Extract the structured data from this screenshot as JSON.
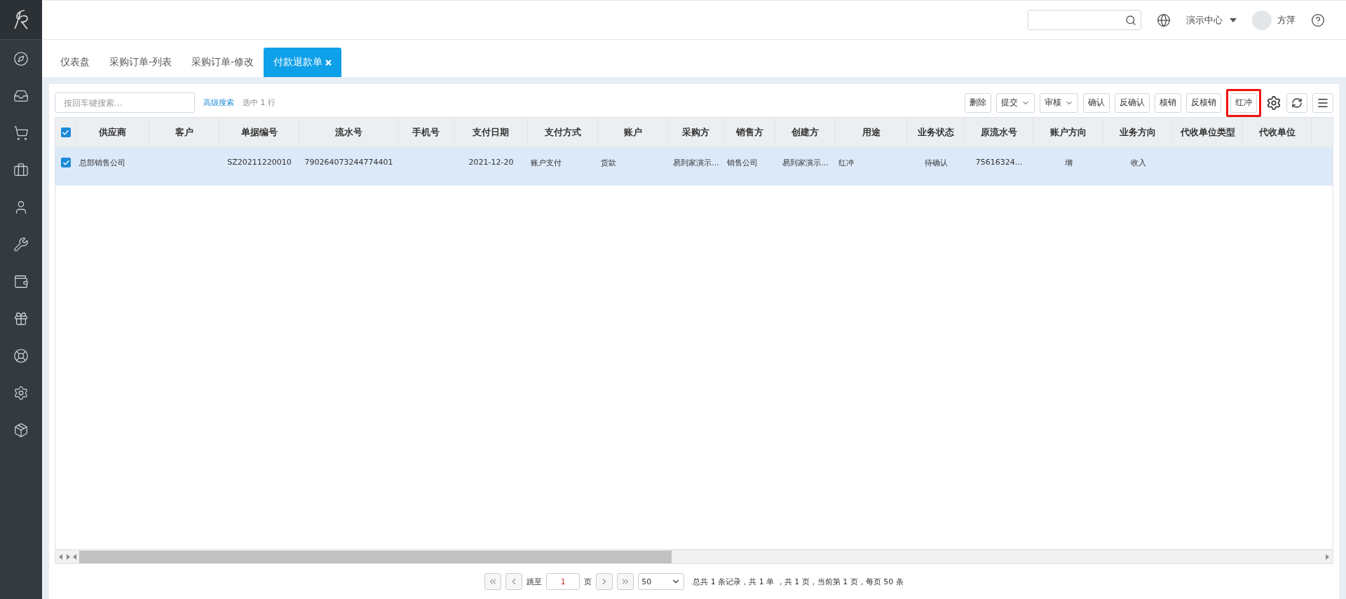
{
  "topbar": {
    "org_menu": "演示中心",
    "user": "方萍"
  },
  "tabs": [
    {
      "label": "仪表盘",
      "selected": false,
      "closable": false
    },
    {
      "label": "采购订单-列表",
      "selected": false,
      "closable": false
    },
    {
      "label": "采购订单-修改",
      "selected": false,
      "closable": false
    },
    {
      "label": "付款退款单",
      "selected": true,
      "closable": true
    }
  ],
  "toolbar": {
    "search": {
      "placeholder": "按回车键搜索..."
    },
    "advanced_search": "高级搜索",
    "selection_info": "选中 1 行",
    "actions": [
      {
        "label": "删除",
        "dropdown": false,
        "highlighted": false
      },
      {
        "label": "提交",
        "dropdown": true,
        "highlighted": false
      },
      {
        "label": "审核",
        "dropdown": true,
        "highlighted": false
      },
      {
        "label": "确认",
        "dropdown": false,
        "highlighted": false
      },
      {
        "label": "反确认",
        "dropdown": false,
        "highlighted": false
      },
      {
        "label": "核销",
        "dropdown": false,
        "highlighted": false
      },
      {
        "label": "反核销",
        "dropdown": false,
        "highlighted": false
      },
      {
        "label": "红冲",
        "dropdown": false,
        "highlighted": true
      }
    ]
  },
  "table": {
    "all_checked": true,
    "columns": [
      {
        "label": "供应商"
      },
      {
        "label": "客户"
      },
      {
        "label": "单据编号"
      },
      {
        "label": "流水号"
      },
      {
        "label": "手机号"
      },
      {
        "label": "支付日期"
      },
      {
        "label": "支付方式"
      },
      {
        "label": "账户"
      },
      {
        "label": "采购方"
      },
      {
        "label": "销售方"
      },
      {
        "label": "创建方"
      },
      {
        "label": "用途"
      },
      {
        "label": "业务状态"
      },
      {
        "label": "原流水号"
      },
      {
        "label": "账户方向"
      },
      {
        "label": "业务方向"
      },
      {
        "label": "代收单位类型"
      },
      {
        "label": "代收单位"
      }
    ],
    "rows": [
      {
        "selected": true,
        "cells": [
          "总部销售公司",
          "",
          "SZ20211220010",
          "790264073244774401",
          "",
          "2021-12-20",
          "账户支付",
          "货款",
          "易到家演示...",
          "销售公司",
          "易到家演示...",
          "红冲",
          "待确认",
          "75616324...",
          "增",
          "收入",
          "",
          ""
        ]
      }
    ]
  },
  "pagination": {
    "jump_label": "跳至",
    "page": "1",
    "page_unit": "页",
    "page_size": "50",
    "summary": "总共 1 条记录，共 1 单 ，共 1 页，当前第 1 页，每页 50 条"
  }
}
